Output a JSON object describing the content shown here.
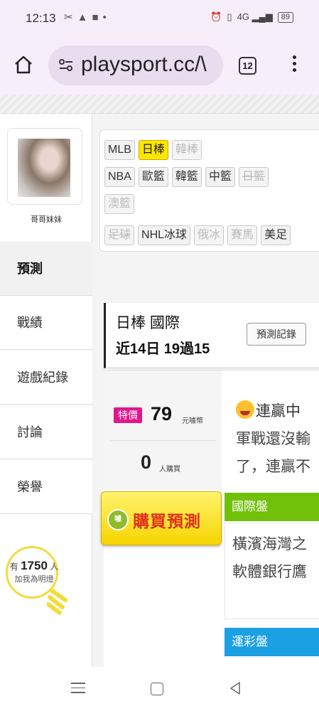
{
  "status_bar": {
    "time": "12:13",
    "left_icons": [
      "tools-icon",
      "cake-icon",
      "android-icon",
      "dot-icon"
    ],
    "right_icons": [
      "alarm-icon",
      "volte-icon",
      "signal-icon"
    ],
    "network": "4G",
    "battery": "89"
  },
  "browser": {
    "url": "playsport.cc/\\",
    "tab_count": "12"
  },
  "sidebar": {
    "profile_name": "哥哥妹妹",
    "tabs": [
      "預測",
      "戰績",
      "遊戲紀錄",
      "討論",
      "榮譽"
    ],
    "active_tab": "預測",
    "fans": {
      "prefix": "有",
      "count": "1750",
      "suffix": "人",
      "line2": "加我為明燈"
    }
  },
  "leagues": {
    "row1": [
      "MLB",
      "日棒",
      "韓棒"
    ],
    "row2": [
      "NBA",
      "歐籃",
      "韓籃",
      "中籃",
      "日籃"
    ],
    "row3": [
      "澳籃"
    ],
    "row4": [
      "足球",
      "NHL冰球",
      "俄冰",
      "賽馬",
      "美足"
    ],
    "active": "日棒",
    "accent": "#ffe600"
  },
  "record": {
    "title": "日棒 國際",
    "stat": "近14日 19過15",
    "button": "預測記錄"
  },
  "prediction": {
    "badge": "特價",
    "price": "79",
    "price_unit": "元噱幣",
    "buyers": "0",
    "buyers_unit": "人購買",
    "buy_button": "購買預測",
    "coin": "噱",
    "streak_title": "連贏中",
    "streak_line2": "軍戰還沒輸",
    "streak_line3": "了，連贏不",
    "market_intl": "國際盤",
    "market_text_1": "橫濱海灣之",
    "market_text_2": "軟體銀行鷹",
    "market_lottery": "運彩盤",
    "colors": {
      "badge": "#e5158b",
      "intl": "#71c10a",
      "lottery": "#1ba0e4",
      "buy": "#e32d1a"
    }
  }
}
